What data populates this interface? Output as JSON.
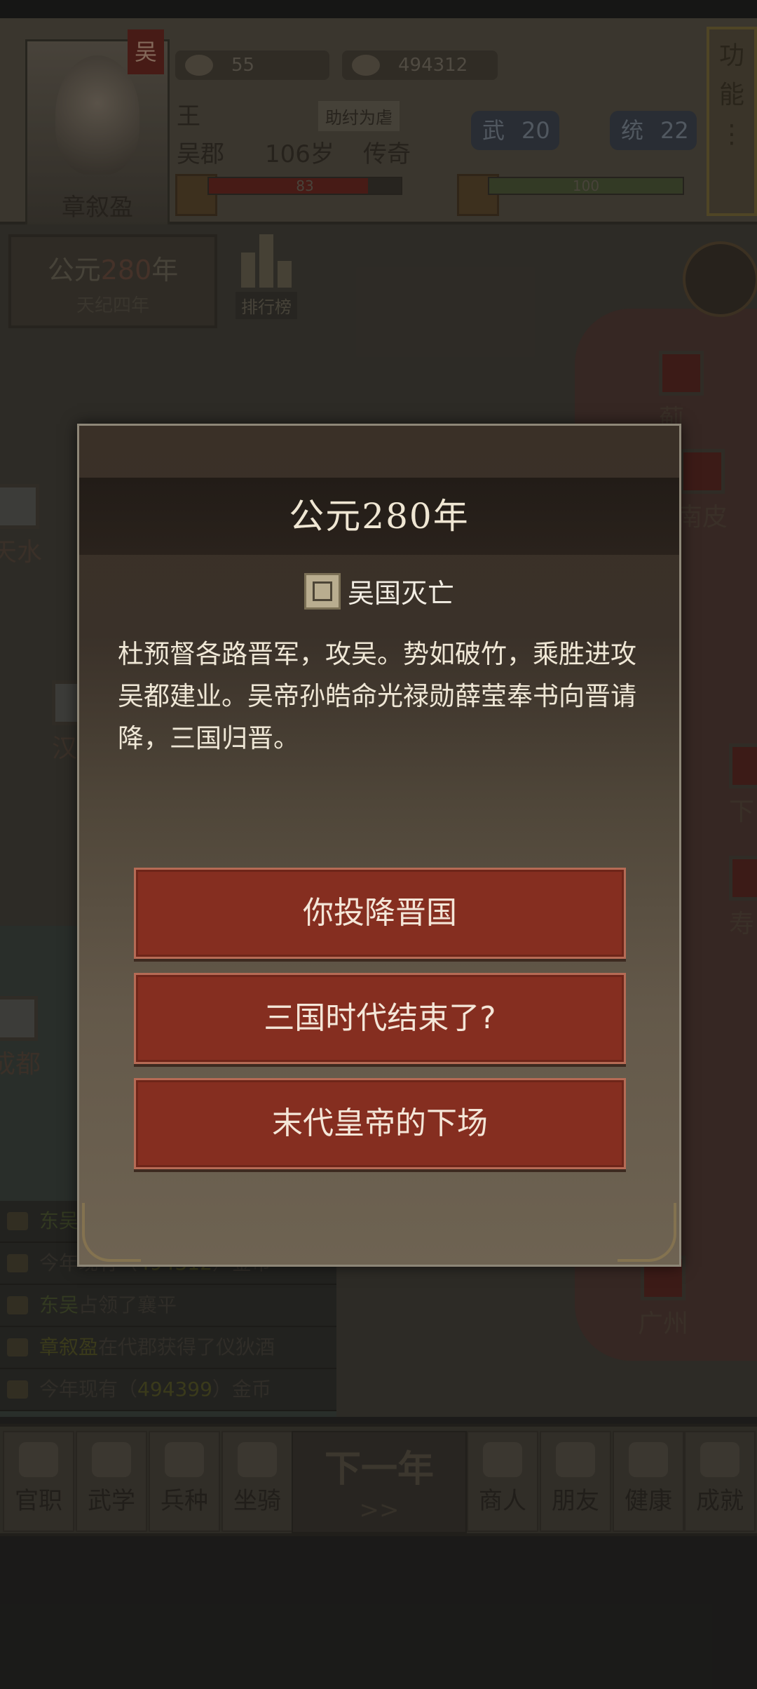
{
  "player": {
    "kingdom": "吴",
    "name_line": "王",
    "city": "吴郡",
    "age": "106岁",
    "rank": "传奇",
    "portrait_name": "章叙盈",
    "title_tag": "助纣为虐"
  },
  "resources": {
    "gold_bars": "55",
    "coins": "494312"
  },
  "stats": {
    "wu_label": "武",
    "wu_value": "20",
    "tong_label": "统",
    "tong_value": "22"
  },
  "bars": {
    "health": {
      "value": "83",
      "fraction": 0.83,
      "color": "#6e2a22"
    },
    "loyalty": {
      "value": "100",
      "fraction": 1.0,
      "color": "#4f5a3a"
    }
  },
  "function_button": {
    "label": "功能",
    "dots": "⋮"
  },
  "year_panel": {
    "prefix": "公元",
    "year": "280",
    "suffix": "年",
    "era": "天纪四年"
  },
  "ranking": {
    "label": "排行榜"
  },
  "map_cities": [
    {
      "name": "蓟"
    },
    {
      "name": "南皮"
    },
    {
      "name": "天水"
    },
    {
      "name": "汉"
    },
    {
      "name": "成都"
    },
    {
      "name": "广州"
    },
    {
      "name": "寿"
    },
    {
      "name": "下"
    }
  ],
  "log": [
    {
      "prefix": "",
      "hl": "东吴",
      "text": ""
    },
    {
      "prefix": "今年现有（",
      "hl": "494312",
      "text": "）金币"
    },
    {
      "prefix": "",
      "hl": "东吴",
      "text": "占领了襄平"
    },
    {
      "prefix": "",
      "hl": "章叙盈",
      "text": "在代郡获得了仪狄酒"
    },
    {
      "prefix": "今年现有（",
      "hl": "494399",
      "text": "）金币"
    }
  ],
  "bottom_nav": [
    {
      "label": "官职"
    },
    {
      "label": "武学"
    },
    {
      "label": "兵种"
    },
    {
      "label": "坐骑"
    },
    {
      "label": "商人"
    },
    {
      "label": "朋友"
    },
    {
      "label": "健康"
    },
    {
      "label": "成就"
    }
  ],
  "next_year": {
    "label": "下一年",
    "arrow": ">>"
  },
  "dialog": {
    "title": "公元280年",
    "event_title": "吴国灭亡",
    "body": "杜预督各路晋军，攻吴。势如破竹，乘胜进攻吴都建业。吴帝孙皓命光禄勋薛莹奉书向晋请降，三国归晋。",
    "choices": [
      {
        "label": "你投降晋国"
      },
      {
        "label": "三国时代结束了?"
      },
      {
        "label": "末代皇帝的下场"
      }
    ]
  }
}
